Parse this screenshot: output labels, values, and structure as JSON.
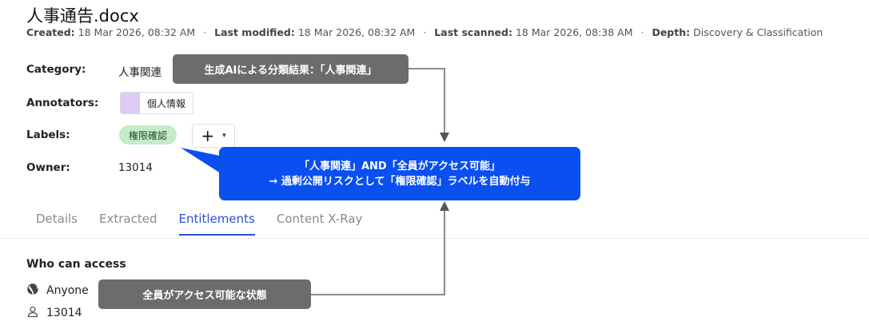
{
  "file": {
    "title": "人事通告.docx"
  },
  "meta": {
    "created_label": "Created:",
    "created_value": "18 Mar 2026, 08:32 AM",
    "modified_label": "Last modified:",
    "modified_value": "18 Mar 2026, 08:32 AM",
    "scanned_label": "Last scanned:",
    "scanned_value": "18 Mar 2026, 08:38 AM",
    "depth_label": "Depth:",
    "depth_value": "Discovery & Classification",
    "separator": "·"
  },
  "fields": {
    "category_label": "Category:",
    "category_value": "人事関連",
    "annotators_label": "Annotators:",
    "annotator_chip": "個人情報",
    "labels_label": "Labels:",
    "label_chip": "権限確認",
    "add_label_plus": "+",
    "add_label_caret": "▾",
    "owner_label": "Owner:",
    "owner_value": "13014"
  },
  "tabs": [
    {
      "label": "Details"
    },
    {
      "label": "Extracted"
    },
    {
      "label": "Entitlements"
    },
    {
      "label": "Content X-Ray"
    }
  ],
  "active_tab": "Entitlements",
  "access": {
    "heading": "Who can access",
    "entries": [
      {
        "icon": "globe-icon",
        "text": "Anyone"
      },
      {
        "icon": "user-icon",
        "text": "13014"
      }
    ]
  },
  "callouts": {
    "category_note": "生成AIによる分類結果：「人事関連」",
    "rule_line1": "「人事関連」AND「全員がアクセス可能」",
    "rule_line2": "→ 過剰公開リスクとして「権限確認」ラベルを自動付与",
    "access_note": "全員がアクセス可能な状態"
  },
  "colors": {
    "accent": "#2b4fd8",
    "callout_blue": "#0a4ff0",
    "callout_gray": "#6c6c6c",
    "label_green": "#c5ebc9",
    "annotator_purple": "#dccbf5"
  }
}
